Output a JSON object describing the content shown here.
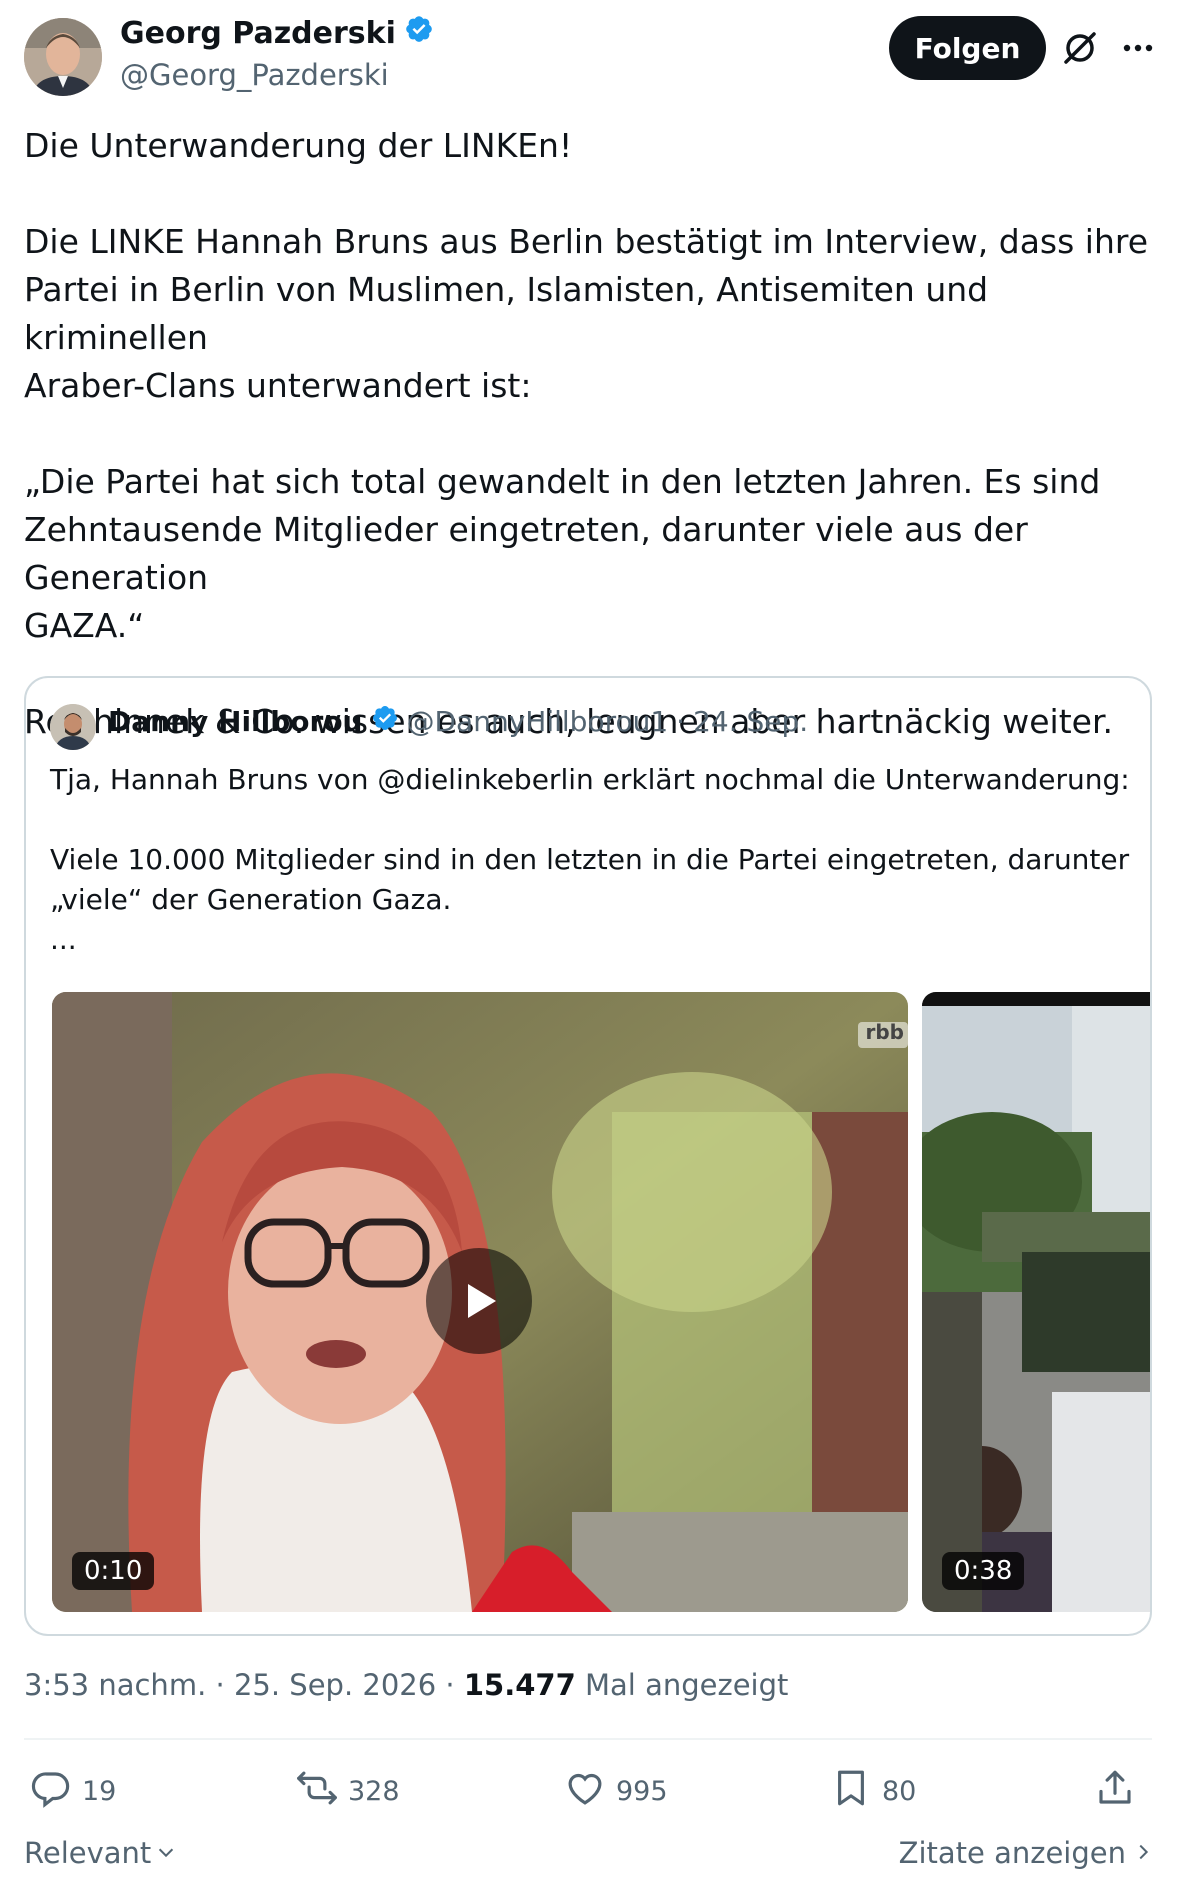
{
  "author": {
    "name": "Georg Pazderski",
    "handle": "@Georg_Pazderski",
    "verified": true
  },
  "header": {
    "follow_label": "Folgen",
    "grok_icon": "grok-icon",
    "more_icon": "more-icon"
  },
  "post": {
    "paragraphs": [
      "Die Unterwanderung der LINKEn!",
      "Die LINKE Hannah Bruns aus Berlin bestätigt im Interview, dass ihre\nPartei in Berlin von Muslimen, Islamisten, Antisemiten und kriminellen\nAraber-Clans unterwandert ist:",
      "„Die Partei hat sich total gewandelt in den letzten Jahren. Es sind\nZehntausende Mitglieder eingetreten, darunter viele aus der Generation\nGAZA.“",
      "Reichinnek & Co. wissen es auch, leugnen aber hartnäckig weiter."
    ]
  },
  "quote": {
    "name": "Danny Hillborou",
    "handle": "@DannyHillborou1",
    "separator": "·",
    "date": "24. Sep.",
    "verified": true,
    "paragraphs": [
      "Tja, Hannah Bruns von @dielinkeberlin erklärt nochmal die Unterwanderung:",
      "Viele 10.000 Mitglieder sind in den letzten in die Partei eingetreten, darunter\n„viele“ der Generation Gaza.\n..."
    ],
    "media": [
      {
        "duration": "0:10",
        "watermark": "rbb"
      },
      {
        "duration": "0:38"
      }
    ]
  },
  "meta": {
    "time": "3:53 nachm.",
    "sep": "·",
    "date": "25. Sep. 2026",
    "views": "15.477",
    "views_label": "Mal angezeigt"
  },
  "actions": {
    "replies": "19",
    "reposts": "328",
    "likes": "995",
    "bookmarks": "80"
  },
  "footer": {
    "sort_label": "Relevant",
    "quotes_label": "Zitate anzeigen"
  },
  "colors": {
    "text": "#0f1419",
    "secondary": "#536471",
    "verified": "#1d9bf0",
    "border": "#cfd9de"
  }
}
